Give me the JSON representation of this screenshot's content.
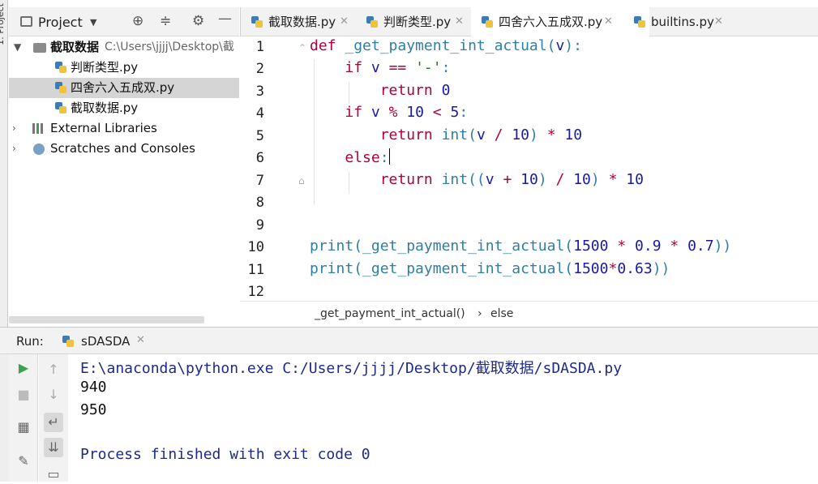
{
  "side_stripe": {
    "label": "1: Project"
  },
  "project_panel": {
    "title": "Project",
    "tree": [
      {
        "name": "截取数据",
        "path": "C:\\Users\\jjjj\\Desktop\\截",
        "kind": "folder"
      },
      {
        "name": "判断类型.py",
        "kind": "py"
      },
      {
        "name": "四舍六入五成双.py",
        "kind": "py",
        "selected": true
      },
      {
        "name": "截取数据.py",
        "kind": "py"
      },
      {
        "name": "External Libraries",
        "kind": "lib"
      },
      {
        "name": "Scratches and Consoles",
        "kind": "scratch"
      }
    ]
  },
  "editor": {
    "tabs": [
      {
        "label": "截取数据.py"
      },
      {
        "label": "判断类型.py"
      },
      {
        "label": "四舍六入五成双.py",
        "active": true
      },
      {
        "label": "builtins.py"
      }
    ],
    "line_numbers": [
      "1",
      "2",
      "3",
      "4",
      "5",
      "6",
      "7",
      "8",
      "9",
      "10",
      "11",
      "12"
    ],
    "current_line": 6,
    "breadcrumb": {
      "function": "_get_payment_int_actual()",
      "separator": "›",
      "block": "else"
    }
  },
  "run_panel": {
    "label": "Run:",
    "tab": "sDASDA",
    "output": [
      "E:\\anaconda\\python.exe C:/Users/jjjj/Desktop/截取数据/sDASDA.py",
      "940",
      "950",
      "",
      "Process finished with exit code 0"
    ]
  },
  "colors": {
    "accent": "#4083c9",
    "keyword": "#b4003a",
    "function": "#2f7fa5",
    "current_line": "#fcf6da"
  }
}
